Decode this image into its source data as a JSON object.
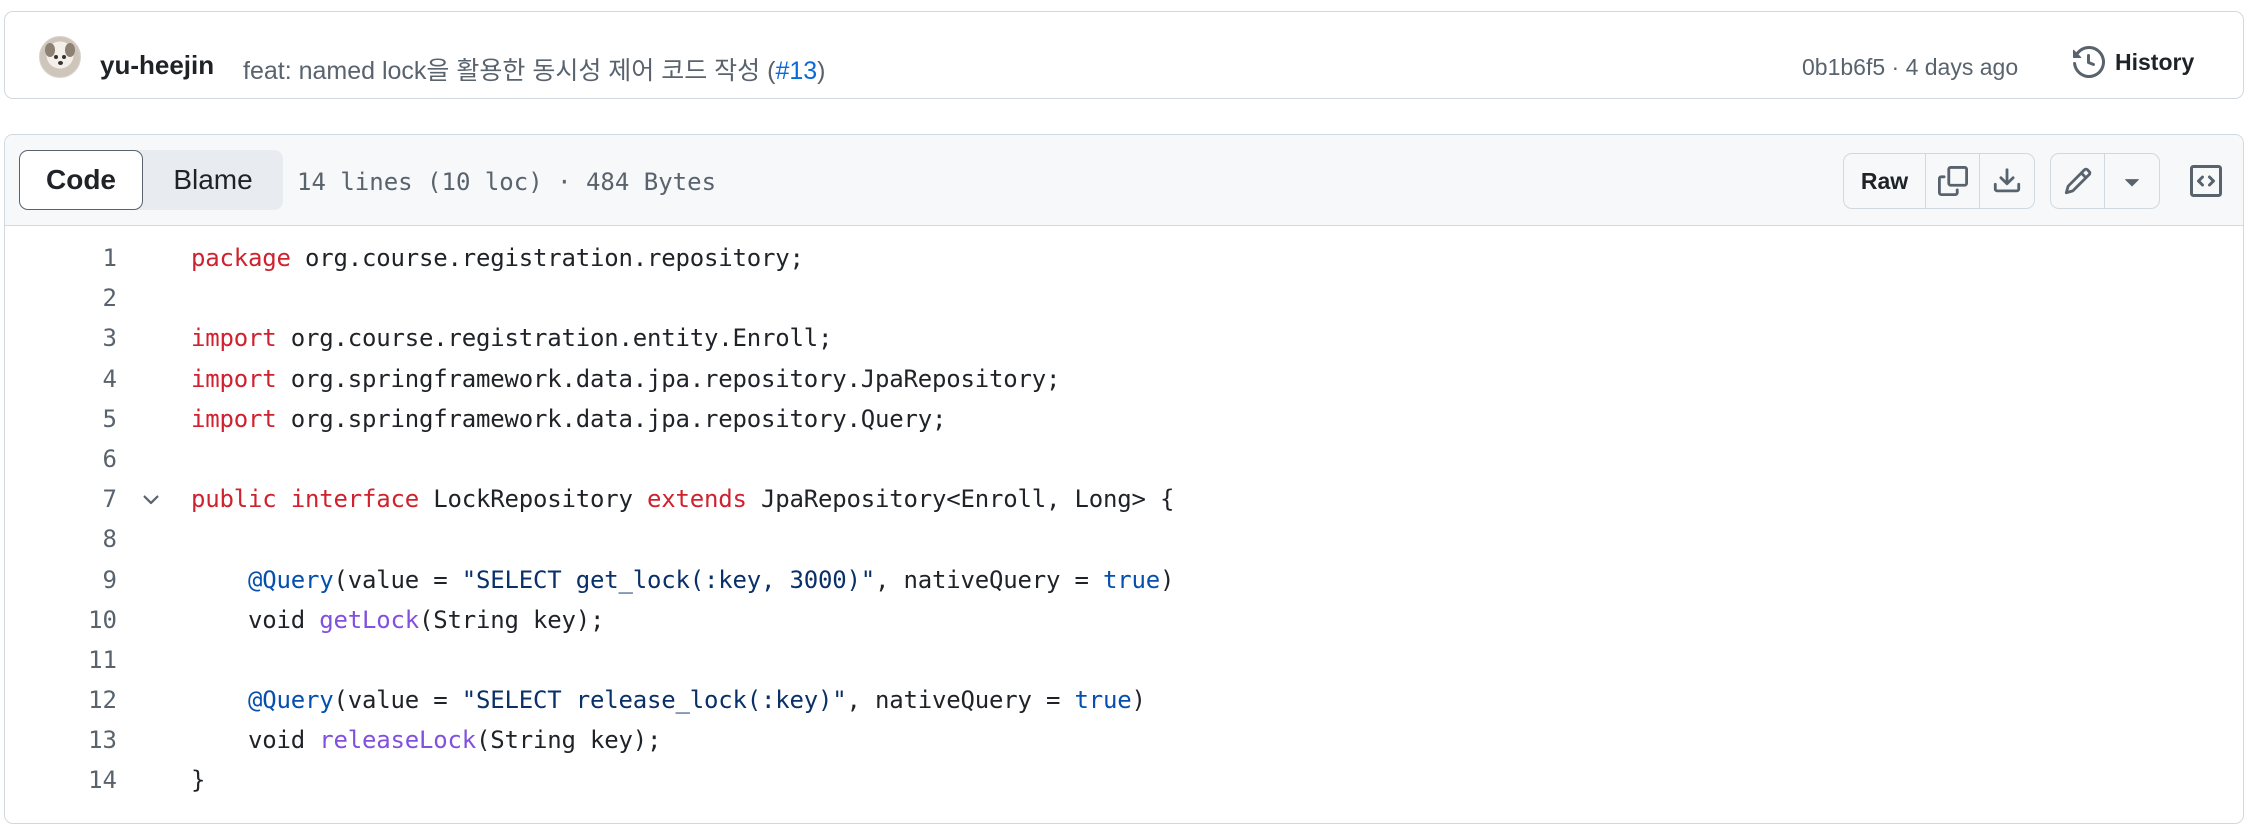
{
  "commit": {
    "author": "yu-heejin",
    "message_prefix": "feat: named lock을 활용한 동시성 제어 코드 작성 (",
    "pr_link": "#13",
    "message_suffix": ")",
    "meta": "0b1b6f5 · 4 days ago",
    "history_label": "History"
  },
  "file_header": {
    "tabs": [
      "Code",
      "Blame"
    ],
    "active_tab": "Code",
    "info": "14 lines (10 loc) · 484 Bytes",
    "raw_label": "Raw"
  },
  "icons": {
    "history": "history-icon",
    "copy": "copy-icon",
    "download": "download-icon",
    "edit": "pencil-icon",
    "dropdown": "triangle-down-icon",
    "symbols": "code-square-icon",
    "fold": "chevron-down-icon"
  },
  "colors": {
    "keyword": "#cf222e",
    "annotation": "#0550ae",
    "string": "#0a3069",
    "function": "#8250df",
    "link": "#0969da"
  },
  "code_lines": [
    {
      "num": "1",
      "tokens": [
        [
          "kw",
          "package"
        ],
        [
          "",
          "org.course.registration.repository;"
        ]
      ]
    },
    {
      "num": "2",
      "tokens": []
    },
    {
      "num": "3",
      "tokens": [
        [
          "kw",
          "import"
        ],
        [
          "",
          "org.course.registration.entity.Enroll;"
        ]
      ]
    },
    {
      "num": "4",
      "tokens": [
        [
          "kw",
          "import"
        ],
        [
          "",
          "org.springframework.data.jpa.repository.JpaRepository;"
        ]
      ]
    },
    {
      "num": "5",
      "tokens": [
        [
          "kw",
          "import"
        ],
        [
          "",
          "org.springframework.data.jpa.repository.Query;"
        ]
      ]
    },
    {
      "num": "6",
      "tokens": []
    },
    {
      "num": "7",
      "fold": true,
      "tokens": [
        [
          "kw",
          "public"
        ],
        [
          "kw",
          "interface"
        ],
        [
          "",
          "LockRepository"
        ],
        [
          "kw",
          "extends"
        ],
        [
          "",
          "JpaRepository<Enroll, Long> {"
        ]
      ]
    },
    {
      "num": "8",
      "tokens": []
    },
    {
      "num": "9",
      "indent": true,
      "tokens": [
        [
          "an",
          "@Query"
        ],
        [
          "",
          "(value = "
        ],
        [
          "st",
          "\"SELECT get_lock(:key, 3000)\""
        ],
        [
          "",
          ", nativeQuery = "
        ],
        [
          "an",
          "true"
        ],
        [
          "",
          ")"
        ]
      ]
    },
    {
      "num": "10",
      "indent": true,
      "tokens": [
        [
          "",
          "void "
        ],
        [
          "fn",
          "getLock"
        ],
        [
          "",
          "(String key);"
        ]
      ]
    },
    {
      "num": "11",
      "tokens": []
    },
    {
      "num": "12",
      "indent": true,
      "tokens": [
        [
          "an",
          "@Query"
        ],
        [
          "",
          "(value = "
        ],
        [
          "st",
          "\"SELECT release_lock(:key)\""
        ],
        [
          "",
          ", nativeQuery = "
        ],
        [
          "an",
          "true"
        ],
        [
          "",
          ")"
        ]
      ]
    },
    {
      "num": "13",
      "indent": true,
      "tokens": [
        [
          "",
          "void "
        ],
        [
          "fn",
          "releaseLock"
        ],
        [
          "",
          "(String key);"
        ]
      ]
    },
    {
      "num": "14",
      "tokens": [
        [
          "",
          "}"
        ]
      ]
    }
  ]
}
